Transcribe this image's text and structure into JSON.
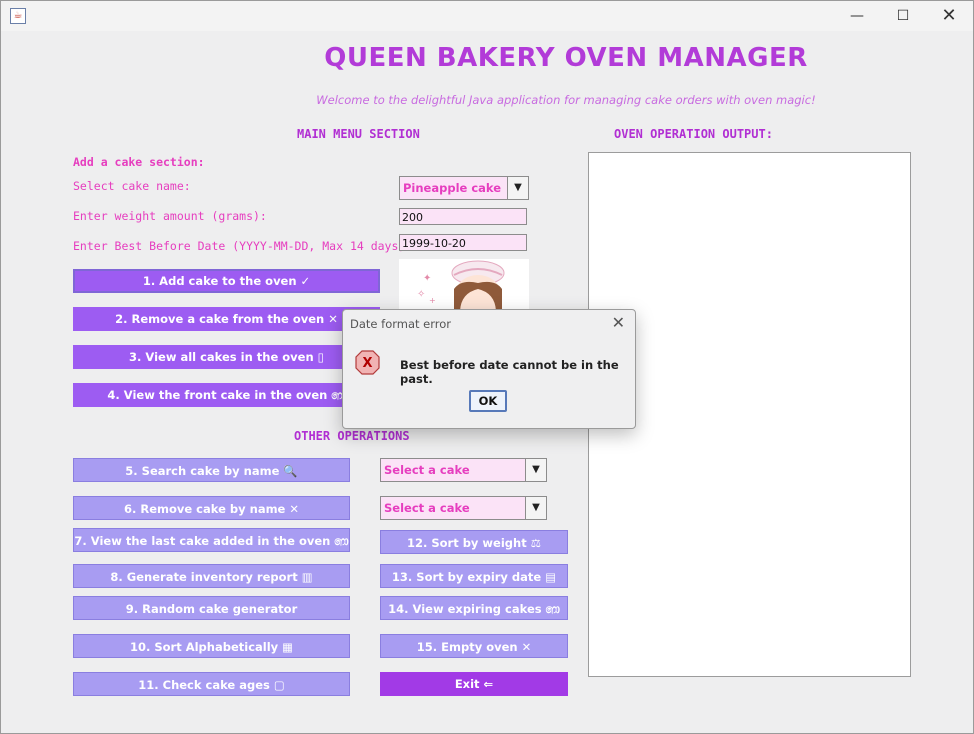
{
  "window": {
    "title_bar": {
      "app_icon": "java-cup-icon",
      "controls": [
        "minimize-icon",
        "maximize-icon",
        "close-icon"
      ]
    }
  },
  "header": {
    "title": "QUEEN BAKERY OVEN MANAGER",
    "subtitle": "Welcome to the delightful Java application for managing cake orders with oven magic!"
  },
  "main_menu": {
    "title": "MAIN MENU SECTION",
    "add_section_label": "Add a cake section:",
    "select_cake_label": "Select cake name:",
    "select_cake_value": "Pineapple cake",
    "weight_label": "Enter weight amount (grams):",
    "weight_value": "200",
    "date_label": "Enter Best Before Date (YYYY-MM-DD, Max 14 days):",
    "date_value": "1999-10-20",
    "buttons": [
      "1. Add cake to the oven ✓",
      "2. Remove a cake from the oven ✕",
      "3. View all cakes in the oven ▯",
      "4. View the front cake in the oven ෩"
    ]
  },
  "other_operations": {
    "title": "OTHER OPERATIONS",
    "search_button": "5. Search cake by name 🔍",
    "search_select": "Select a cake",
    "remove_button": "6. Remove cake by name ✕",
    "remove_select": "Select a cake",
    "left_buttons": [
      "7. View the last cake added in the oven ෩",
      "8. Generate inventory report ▥",
      "9. Random cake generator",
      "10. Sort Alphabetically ▦",
      "11. Check cake ages ▢"
    ],
    "right_buttons": [
      "12. Sort by weight ⚖",
      "13. Sort by expiry date ▤",
      "14. View expiring cakes ෩",
      "15. Empty oven ✕",
      "Exit ⇐"
    ]
  },
  "output": {
    "title": "OVEN OPERATION OUTPUT:",
    "content": ""
  },
  "dialog": {
    "title": "Date format error",
    "message": "Best before date cannot be in the past.",
    "ok_label": "OK",
    "icon": "error-x-icon"
  }
}
